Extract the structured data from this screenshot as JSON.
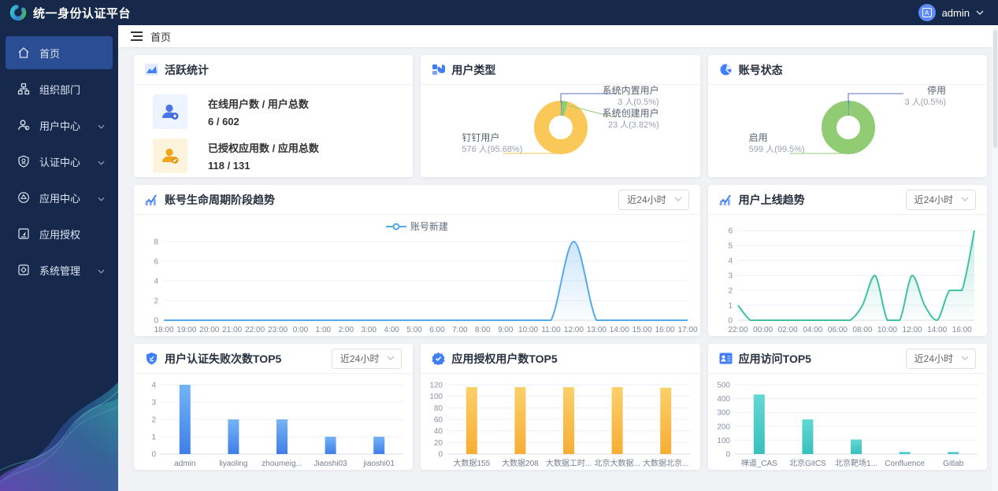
{
  "topbar": {
    "title": "统一身份认证平台",
    "username": "admin"
  },
  "sidebar": {
    "items": [
      {
        "label": "首页",
        "active": true,
        "expandable": false
      },
      {
        "label": "组织部门",
        "active": false,
        "expandable": false
      },
      {
        "label": "用户中心",
        "active": false,
        "expandable": true
      },
      {
        "label": "认证中心",
        "active": false,
        "expandable": true
      },
      {
        "label": "应用中心",
        "active": false,
        "expandable": true
      },
      {
        "label": "应用授权",
        "active": false,
        "expandable": false
      },
      {
        "label": "系统管理",
        "active": false,
        "expandable": true
      }
    ]
  },
  "breadcrumb": {
    "label": "首页"
  },
  "cards": {
    "active_stats": {
      "title": "活跃统计",
      "rows": [
        {
          "label": "在线用户数 / 用户总数",
          "value": "6 / 602"
        },
        {
          "label": "已授权应用数 / 应用总数",
          "value": "118 / 131"
        }
      ]
    },
    "user_type": {
      "title": "用户类型",
      "chart": {
        "type": "donut",
        "slices": [
          {
            "label": "系统内置用户",
            "value": 3,
            "value_text": "3 人(0.5%)",
            "color": "#5470c6",
            "slot": "right-top"
          },
          {
            "label": "系统创建用户",
            "value": 23,
            "value_text": "23 人(3.82%)",
            "color": "#91cc75",
            "slot": "right-mid"
          },
          {
            "label": "钉钉用户",
            "value": 576,
            "value_text": "576 人(95.68%)",
            "color": "#fac858",
            "slot": "left"
          }
        ]
      }
    },
    "account_status": {
      "title": "账号状态",
      "chart": {
        "type": "donut",
        "slices": [
          {
            "label": "停用",
            "value": 3,
            "value_text": "3 人(0.5%)",
            "color": "#5470c6",
            "slot": "right-top"
          },
          {
            "label": "启用",
            "value": 599,
            "value_text": "599 人(99.5%)",
            "color": "#91cc75",
            "slot": "left"
          }
        ]
      }
    },
    "lifecycle": {
      "title": "账号生命周期阶段趋势",
      "range_label": "近24小时",
      "chart": {
        "type": "line",
        "legend": "账号新建",
        "color": "#55aaec",
        "x": [
          "18:00",
          "19:00",
          "20:00",
          "21:00",
          "22:00",
          "23:00",
          "0:00",
          "1:00",
          "2:00",
          "3:00",
          "4:00",
          "5:00",
          "6:00",
          "7:00",
          "8:00",
          "9:00",
          "10:00",
          "11:00",
          "12:00",
          "13:00",
          "14:00",
          "15:00",
          "16:00",
          "17:00"
        ],
        "values": [
          0,
          0,
          0,
          0,
          0,
          0,
          0,
          0,
          0,
          0,
          0,
          0,
          0,
          0,
          0,
          0,
          0,
          0,
          8,
          0,
          0,
          0,
          0,
          0
        ],
        "label_step": 1,
        "yticks": [
          0,
          2,
          4,
          6,
          8
        ],
        "ymax": 8
      }
    },
    "online_trend": {
      "title": "用户上线趋势",
      "range_label": "近24小时",
      "chart": {
        "type": "line",
        "color": "#3ec2a0",
        "x": [
          "22:00",
          "23:00",
          "00:00",
          "01:00",
          "02:00",
          "03:00",
          "04:00",
          "05:00",
          "06:00",
          "07:00",
          "08:00",
          "09:00",
          "10:00",
          "11:00",
          "12:00",
          "13:00",
          "14:00",
          "15:00",
          "16:00",
          "17:00"
        ],
        "values": [
          1,
          0,
          0,
          0,
          0,
          0,
          0,
          0,
          0,
          0,
          1,
          3,
          0,
          0,
          3,
          1,
          0,
          2,
          2,
          6
        ],
        "label_step": 2,
        "yticks": [
          0,
          1,
          2,
          3,
          4,
          5,
          6
        ],
        "ymax": 6
      }
    },
    "auth_fail": {
      "title": "用户认证失败次数TOP5",
      "range_label": "近24小时",
      "chart": {
        "type": "bar",
        "categories": [
          "admin",
          "liyaoling",
          "zhoumeig...",
          "Jiaoshi03",
          "jiaoshi01"
        ],
        "values": [
          4,
          2,
          2,
          1,
          1
        ],
        "bar_colors": [
          "#74b4f5",
          "#3f7ee8"
        ],
        "yticks": [
          0,
          1,
          2,
          3,
          4
        ],
        "ymax": 4
      }
    },
    "app_auth_users": {
      "title": "应用授权用户数TOP5",
      "chart": {
        "type": "bar",
        "categories": [
          "大数据155",
          "大数据208",
          "大数据工时...",
          "北京大数据...",
          "大数据北京..."
        ],
        "values": [
          116,
          116,
          116,
          116,
          115
        ],
        "bar_colors": [
          "#fbd06a",
          "#f7ad34"
        ],
        "yticks": [
          0,
          20,
          40,
          60,
          80,
          100,
          120
        ],
        "ymax": 120
      }
    },
    "app_access": {
      "title": "应用访问TOP5",
      "range_label": "近24小时",
      "chart": {
        "type": "bar",
        "categories": [
          "禅道_CAS",
          "北京GitCS",
          "北京靶场1...",
          "Confluence",
          "Gitlab"
        ],
        "values": [
          430,
          250,
          105,
          15,
          15
        ],
        "bar_colors": [
          "#63d8d2",
          "#38bfbf"
        ],
        "yticks": [
          0,
          100,
          200,
          300,
          400,
          500
        ],
        "ymax": 500
      }
    }
  }
}
